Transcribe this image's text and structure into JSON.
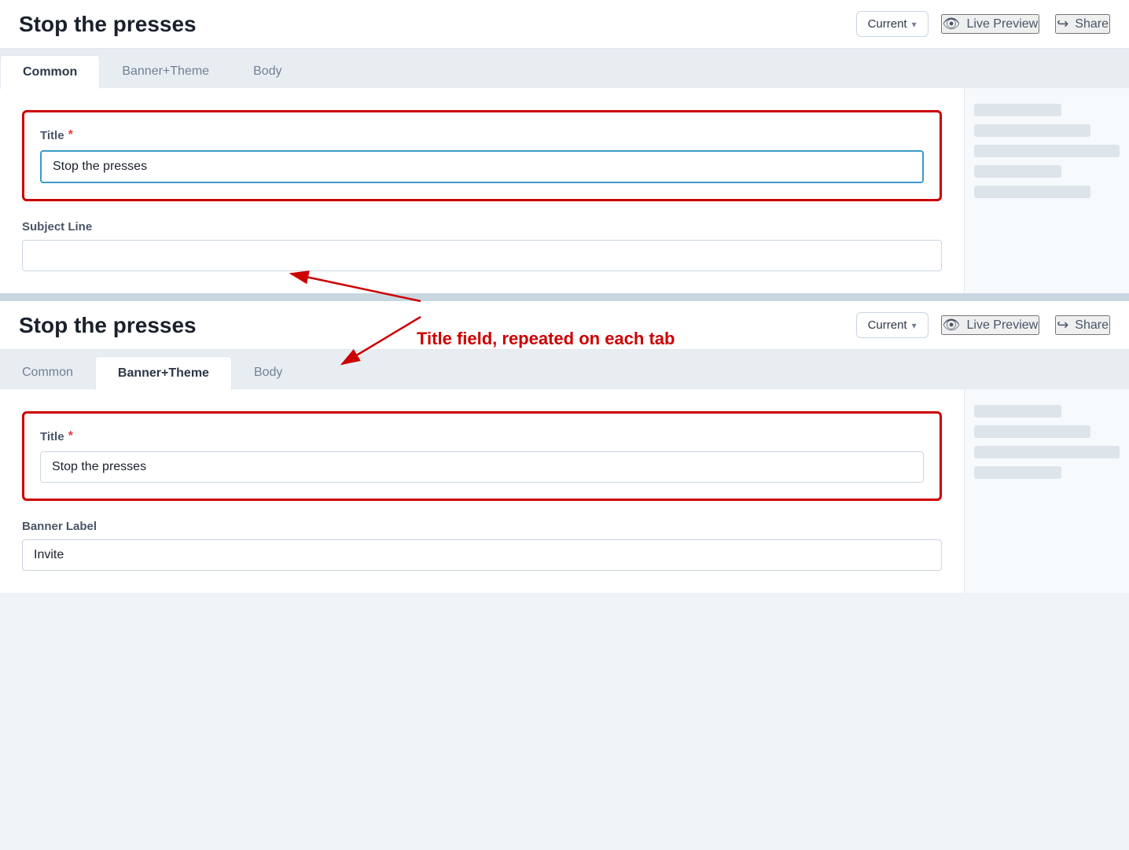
{
  "top_panel": {
    "title": "Stop the presses",
    "version_label": "Current",
    "live_preview_label": "Live Preview",
    "share_label": "Share",
    "tabs": [
      {
        "id": "common",
        "label": "Common",
        "active": true
      },
      {
        "id": "banner_theme",
        "label": "Banner+Theme",
        "active": false
      },
      {
        "id": "body",
        "label": "Body",
        "active": false
      }
    ],
    "title_field": {
      "label": "Title",
      "required": true,
      "value": "Stop the presses",
      "placeholder": ""
    },
    "subject_line_field": {
      "label": "Subject Line",
      "required": false,
      "value": "",
      "placeholder": ""
    }
  },
  "annotation": {
    "text": "Title field, repeated on each tab"
  },
  "bottom_panel": {
    "title": "Stop the presses",
    "version_label": "Current",
    "live_preview_label": "Live Preview",
    "share_label": "Share",
    "tabs": [
      {
        "id": "common",
        "label": "Common",
        "active": false
      },
      {
        "id": "banner_theme",
        "label": "Banner+Theme",
        "active": true
      },
      {
        "id": "body",
        "label": "Body",
        "active": false
      }
    ],
    "title_field": {
      "label": "Title",
      "required": true,
      "value": "Stop the presses"
    },
    "banner_label_field": {
      "label": "Banner Label",
      "required": false,
      "value": "Invite"
    }
  },
  "icons": {
    "eye": "👁",
    "share": "↪",
    "chevron_down": "∨"
  }
}
